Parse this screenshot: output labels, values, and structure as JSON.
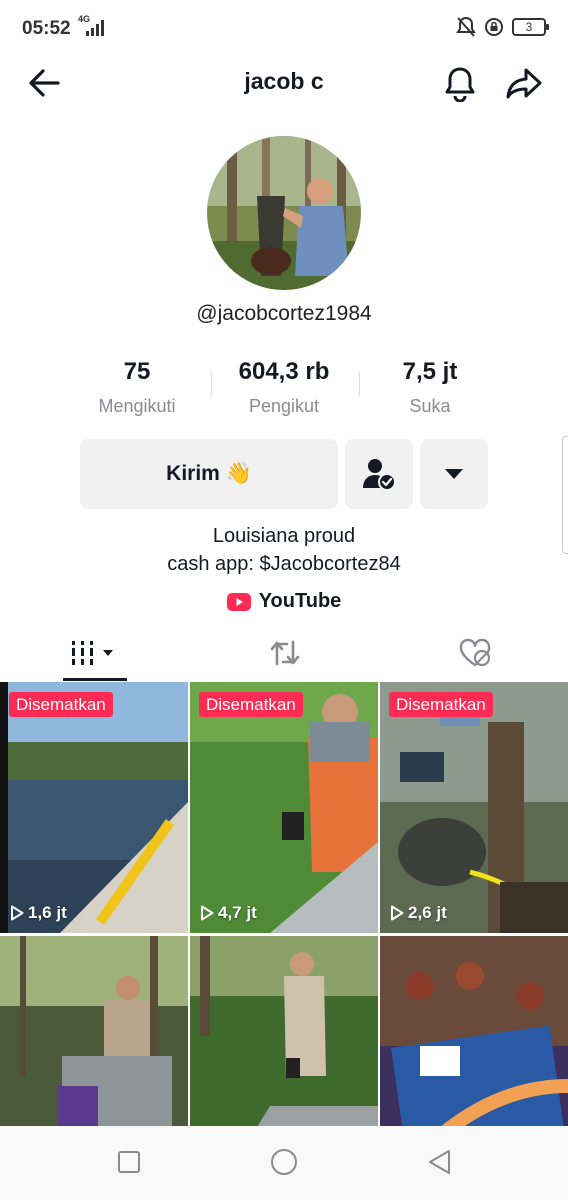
{
  "status_bar": {
    "time": "05:52",
    "network": "4G",
    "battery": "3"
  },
  "header": {
    "title": "jacob c"
  },
  "profile": {
    "username": "@jacobcortez1984"
  },
  "stats": [
    {
      "value": "75",
      "label": "Mengikuti"
    },
    {
      "value": "604,3 rb",
      "label": "Pengikut"
    },
    {
      "value": "7,5 jt",
      "label": "Suka"
    }
  ],
  "actions": {
    "send_label": "Kirim 👋"
  },
  "bio": {
    "line1": "Louisiana proud",
    "line2": "cash app: $Jacobcortez84",
    "link_label": "YouTube"
  },
  "colors": {
    "accent": "#fe2c55",
    "text": "#161823",
    "secondary": "#8a8b91",
    "button_bg": "#f1f1f2"
  },
  "videos": [
    {
      "pinned_label": "Disematkan",
      "views": "1,6 jt"
    },
    {
      "pinned_label": "Disematkan",
      "views": "4,7 jt"
    },
    {
      "pinned_label": "Disematkan",
      "views": "2,6 jt"
    },
    {
      "pinned_label": "",
      "views": ""
    },
    {
      "pinned_label": "",
      "views": ""
    },
    {
      "pinned_label": "",
      "views": ""
    }
  ]
}
